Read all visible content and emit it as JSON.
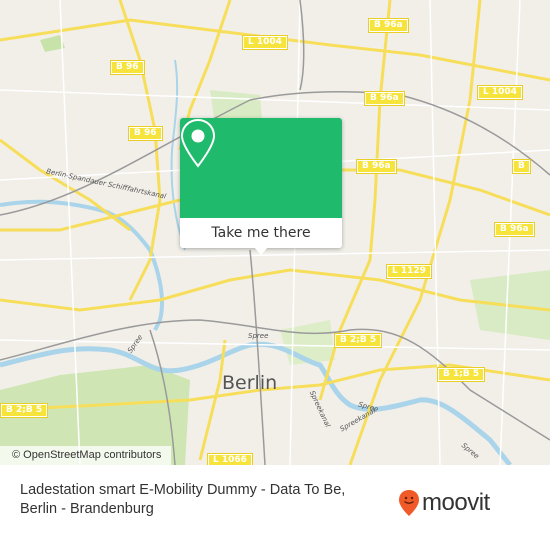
{
  "map": {
    "city_label": "Berlin",
    "attribution": "© OpenStreetMap contributors",
    "road_shields": [
      {
        "label": "L 1004"
      },
      {
        "label": "B 96a"
      },
      {
        "label": "B 96"
      },
      {
        "label": "B 96a"
      },
      {
        "label": "L 1004"
      },
      {
        "label": "B 96"
      },
      {
        "label": "B 96a"
      },
      {
        "label": "B 96a"
      },
      {
        "label": "L 1129"
      },
      {
        "label": "B 2;B 5"
      },
      {
        "label": "B 1;B 5"
      },
      {
        "label": "B 2;B 5"
      },
      {
        "label": "L 1066"
      },
      {
        "label": "B"
      }
    ],
    "water_labels": [
      {
        "label": "Berlin-Spandauer Schifffahrtskanal"
      },
      {
        "label": "Spree"
      },
      {
        "label": "Spree"
      },
      {
        "label": "Spreekanal"
      },
      {
        "label": "Spreekanal"
      },
      {
        "label": "Spree"
      },
      {
        "label": "Spree"
      }
    ]
  },
  "popup": {
    "pin_icon": "map-pin-icon",
    "button_label": "Take me there",
    "accent_color": "#1fba6b"
  },
  "footer": {
    "title_line1": "Ladestation smart E-Mobility Dummy - Data To Be,",
    "title_line2": "Berlin - Brandenburg",
    "logo_text": "moovit",
    "logo_color": "#f05a28"
  }
}
